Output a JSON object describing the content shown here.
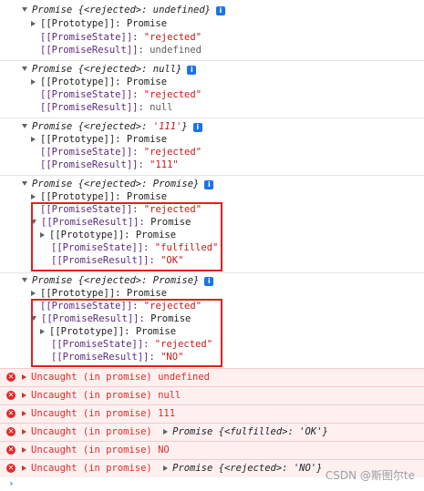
{
  "logs": [
    {
      "header_prefix": "Promise {<rejected>: ",
      "header_value": "undefined",
      "header_suffix": "}",
      "proto": "[[Prototype]]: Promise",
      "state_key": "[[PromiseState]]: ",
      "state_val": "\"rejected\"",
      "result_key": "[[PromiseResult]]: ",
      "result_val": "undefined"
    },
    {
      "header_prefix": "Promise {<rejected>: ",
      "header_value": "null",
      "header_suffix": "}",
      "proto": "[[Prototype]]: Promise",
      "state_key": "[[PromiseState]]: ",
      "state_val": "\"rejected\"",
      "result_key": "[[PromiseResult]]: ",
      "result_val": "null"
    },
    {
      "header_prefix": "Promise {<rejected>: ",
      "header_value": "'111'",
      "header_suffix": "}",
      "proto": "[[Prototype]]: Promise",
      "state_key": "[[PromiseState]]: ",
      "state_val": "\"rejected\"",
      "result_key": "[[PromiseResult]]: ",
      "result_val": "\"111\""
    },
    {
      "header_prefix": "Promise {<rejected>: ",
      "header_value": "Promise",
      "header_suffix": "}",
      "proto": "[[Prototype]]: Promise",
      "state_key": "[[PromiseState]]: ",
      "state_val": "\"rejected\"",
      "result_key": "[[PromiseResult]]: ",
      "result_val": "Promise",
      "inner_proto": "[[Prototype]]: Promise",
      "inner_state_key": "[[PromiseState]]: ",
      "inner_state_val": "\"fulfilled\"",
      "inner_result_key": "[[PromiseResult]]: ",
      "inner_result_val": "\"OK\""
    },
    {
      "header_prefix": "Promise {<rejected>: ",
      "header_value": "Promise",
      "header_suffix": "}",
      "proto": "[[Prototype]]: Promise",
      "state_key": "[[PromiseState]]: ",
      "state_val": "\"rejected\"",
      "result_key": "[[PromiseResult]]: ",
      "result_val": "Promise",
      "inner_proto": "[[Prototype]]: Promise",
      "inner_state_key": "[[PromiseState]]: ",
      "inner_state_val": "\"rejected\"",
      "inner_result_key": "[[PromiseResult]]: ",
      "inner_result_val": "\"NO\""
    }
  ],
  "errors": [
    {
      "text": "Uncaught (in promise) undefined",
      "obj": ""
    },
    {
      "text": "Uncaught (in promise) null",
      "obj": ""
    },
    {
      "text": "Uncaught (in promise) 111",
      "obj": ""
    },
    {
      "text": "Uncaught (in promise) ",
      "obj": "Promise {<fulfilled>: 'OK'}"
    },
    {
      "text": "Uncaught (in promise) NO",
      "obj": ""
    },
    {
      "text": "Uncaught (in promise) ",
      "obj": "Promise {<rejected>: 'NO'}"
    }
  ],
  "icons": {
    "info": "info-icon",
    "error": "error-icon",
    "prompt": "prompt-chevron-icon"
  },
  "watermark": "CSDN @斯图尔te",
  "colors": {
    "error": "#e02a2a",
    "string": "#c41a16",
    "highlight_box": "#e0201b"
  }
}
